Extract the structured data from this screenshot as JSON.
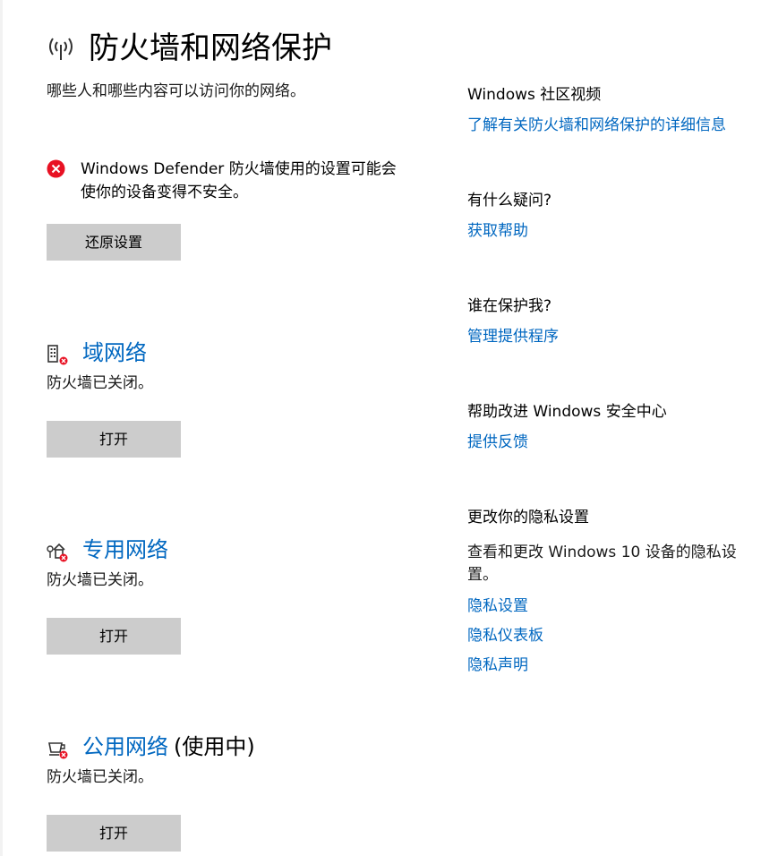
{
  "header": {
    "title": "防火墙和网络保护",
    "subtitle": "哪些人和哪些内容可以访问你的网络。"
  },
  "warning": {
    "icon": "error-icon",
    "color": "#e81123",
    "line1": "Windows Defender 防火墙使用的设置可能会",
    "line2": "使你的设备变得不安全。",
    "restore_label": "还原设置"
  },
  "networks": [
    {
      "icon": "domain-network-icon",
      "title": "域网络",
      "suffix": "",
      "status": "防火墙已关闭。",
      "button": "打开"
    },
    {
      "icon": "private-network-icon",
      "title": "专用网络",
      "suffix": "",
      "status": "防火墙已关闭。",
      "button": "打开"
    },
    {
      "icon": "public-network-icon",
      "title": "公用网络",
      "suffix": "(使用中)",
      "status": "防火墙已关闭。",
      "button": "打开"
    }
  ],
  "side": {
    "community": {
      "heading": "Windows 社区视频",
      "link": "了解有关防火墙和网络保护的详细信息"
    },
    "question": {
      "heading": "有什么疑问?",
      "link": "获取帮助"
    },
    "protect": {
      "heading": "谁在保护我?",
      "link": "管理提供程序"
    },
    "improve": {
      "heading": "帮助改进 Windows 安全中心",
      "link": "提供反馈"
    },
    "privacy": {
      "heading": "更改你的隐私设置",
      "body": "查看和更改 Windows 10 设备的隐私设置。",
      "links": [
        "隐私设置",
        "隐私仪表板",
        "隐私声明"
      ]
    }
  },
  "colors": {
    "accent": "#0067c0",
    "button_bg": "#cccccc",
    "error": "#e81123"
  }
}
